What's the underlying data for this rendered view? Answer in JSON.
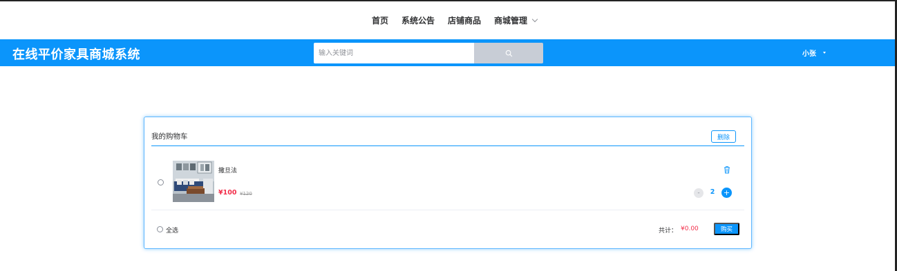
{
  "nav": {
    "items": [
      {
        "label": "首页"
      },
      {
        "label": "系统公告"
      },
      {
        "label": "店铺商品"
      },
      {
        "label": "商城管理"
      }
    ]
  },
  "header": {
    "brand": "在线平价家具商城系统",
    "search_placeholder": "输入关键词",
    "search_icon": "search-icon",
    "user_name": "小张"
  },
  "cart": {
    "title": "我的购物车",
    "delete_label": "删除",
    "items": [
      {
        "name": "撒旦法",
        "price": "¥100",
        "old_price": "¥120",
        "quantity": "2",
        "minus_label": "-",
        "plus_label": "+",
        "image": "sofa-living-room"
      }
    ],
    "select_all_label": "全选",
    "total_label": "共计：",
    "total_value": "¥0.00",
    "buy_label": "购买"
  },
  "colors": {
    "primary": "#0b95fb",
    "price": "#f22e4a"
  }
}
